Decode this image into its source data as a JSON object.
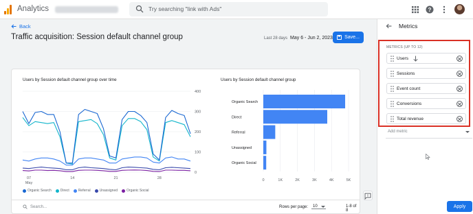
{
  "topbar": {
    "app_name": "Analytics",
    "search_placeholder": "Try searching \"link with Ads\""
  },
  "header": {
    "back_label": "Back",
    "title": "Traffic acquisition: Session default channel group",
    "date_label": "Last 28 days",
    "date_range": "May 6 - Jun 2, 2023",
    "save_label": "Save..."
  },
  "line_chart": {
    "title": "Users by Session default channel group over time",
    "x_ticks": [
      "07",
      "14",
      "21",
      "28"
    ],
    "x_month": "May",
    "y_ticks": [
      "400",
      "300",
      "200",
      "100",
      "0"
    ],
    "legend": [
      {
        "label": "Organic Search",
        "color": "#1967d2"
      },
      {
        "label": "Direct",
        "color": "#12b5cb"
      },
      {
        "label": "Referral",
        "color": "#4285f4"
      },
      {
        "label": "Unassigned",
        "color": "#3949ab"
      },
      {
        "label": "Organic Social",
        "color": "#7b1fa2"
      }
    ]
  },
  "bar_chart": {
    "title": "Users by Session default channel group",
    "x_ticks": [
      "0",
      "1K",
      "2K",
      "3K",
      "4K",
      "5K"
    ]
  },
  "table_footer": {
    "search_placeholder": "Search...",
    "rows_per_page_label": "Rows per page:",
    "rows_per_page_value": "10",
    "range_text": "1-8 of 8"
  },
  "panel": {
    "title": "Metrics",
    "section_label": "METRICS (UP TO 12)",
    "metrics": [
      {
        "name": "Users"
      },
      {
        "name": "Sessions"
      },
      {
        "name": "Event count"
      },
      {
        "name": "Conversions"
      },
      {
        "name": "Total revenue"
      }
    ],
    "add_metric_label": "Add metric",
    "apply_label": "Apply"
  },
  "colors": {
    "accent": "#1a73e8",
    "highlight_box": "#d93025",
    "bar": "#4285f4"
  },
  "chart_data": [
    {
      "type": "line",
      "title": "Users by Session default channel group over time",
      "x": [
        "May 6",
        "May 7",
        "May 8",
        "May 9",
        "May 10",
        "May 11",
        "May 12",
        "May 13",
        "May 14",
        "May 15",
        "May 16",
        "May 17",
        "May 18",
        "May 19",
        "May 20",
        "May 21",
        "May 22",
        "May 23",
        "May 24",
        "May 25",
        "May 26",
        "May 27",
        "May 28",
        "May 29",
        "May 30",
        "May 31",
        "Jun 1",
        "Jun 2"
      ],
      "ylim": [
        0,
        400
      ],
      "series": [
        {
          "name": "Organic Search",
          "values": [
            300,
            240,
            295,
            300,
            285,
            285,
            200,
            45,
            45,
            285,
            310,
            300,
            290,
            215,
            80,
            70,
            260,
            300,
            300,
            280,
            245,
            90,
            60,
            270,
            305,
            290,
            280,
            190
          ]
        },
        {
          "name": "Direct",
          "values": [
            270,
            230,
            250,
            245,
            240,
            245,
            175,
            45,
            40,
            250,
            255,
            260,
            240,
            185,
            70,
            60,
            230,
            265,
            265,
            250,
            210,
            75,
            55,
            245,
            255,
            245,
            235,
            175
          ]
        },
        {
          "name": "Referral",
          "values": [
            60,
            55,
            65,
            70,
            70,
            65,
            55,
            35,
            35,
            65,
            70,
            70,
            65,
            60,
            45,
            45,
            65,
            70,
            75,
            75,
            70,
            50,
            45,
            70,
            75,
            65,
            65,
            55
          ]
        },
        {
          "name": "Unassigned",
          "values": [
            20,
            18,
            22,
            25,
            22,
            20,
            18,
            12,
            12,
            22,
            25,
            22,
            20,
            18,
            14,
            12,
            22,
            25,
            24,
            22,
            20,
            14,
            12,
            22,
            24,
            22,
            20,
            18
          ]
        },
        {
          "name": "Organic Social",
          "values": [
            8,
            6,
            10,
            10,
            8,
            9,
            7,
            3,
            3,
            9,
            10,
            10,
            9,
            7,
            4,
            4,
            9,
            10,
            11,
            10,
            8,
            4,
            3,
            10,
            10,
            9,
            9,
            7
          ]
        }
      ]
    },
    {
      "type": "bar",
      "title": "Users by Session default channel group",
      "orientation": "horizontal",
      "categories": [
        "Organic Search",
        "Direct",
        "Referral",
        "Unassigned",
        "Organic Social"
      ],
      "values": [
        4800,
        3750,
        700,
        180,
        170
      ],
      "xlim": [
        0,
        5000
      ]
    }
  ]
}
